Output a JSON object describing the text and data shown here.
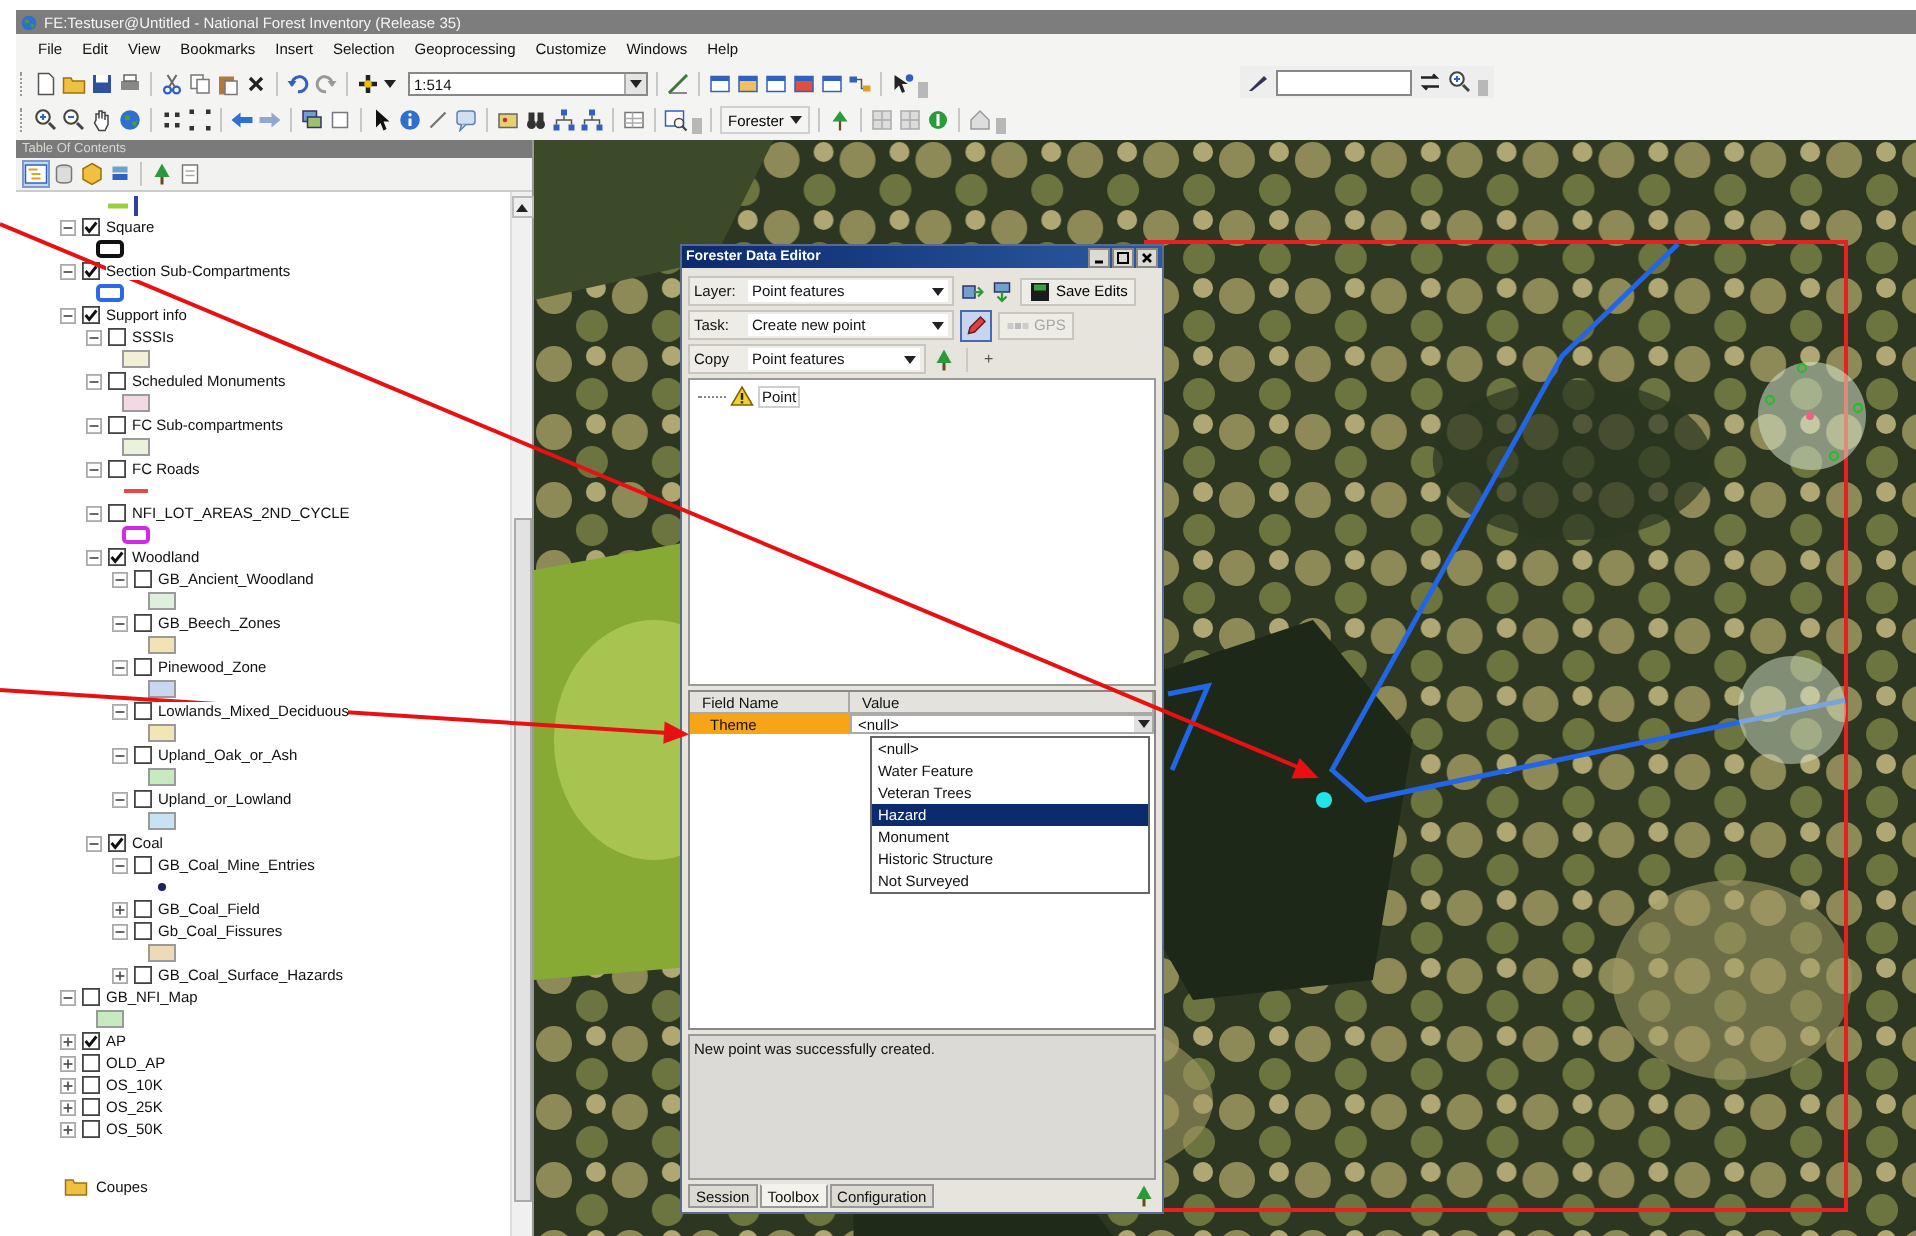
{
  "window": {
    "title": "FE:Testuser@Untitled - National Forest Inventory (Release 35)"
  },
  "menu": [
    "File",
    "Edit",
    "View",
    "Bookmarks",
    "Insert",
    "Selection",
    "Geoprocessing",
    "Customize",
    "Windows",
    "Help"
  ],
  "toolbar": {
    "scale": "1:514",
    "forester_menu": "Forester"
  },
  "toc": {
    "title": "Table Of Contents",
    "layers": [
      {
        "name": "Square",
        "checked": true,
        "expanded": true,
        "legend": {
          "kind": "outline",
          "color": "#111111"
        }
      },
      {
        "name": "Section Sub-Compartments",
        "checked": true,
        "expanded": true,
        "legend": {
          "kind": "outline",
          "color": "#2a6ae8"
        }
      },
      {
        "name": "Support info",
        "checked": true,
        "expanded": true,
        "children": [
          {
            "name": "SSSIs",
            "checked": false,
            "expanded": true,
            "legend": {
              "kind": "fill",
              "color": "#f2f0d4"
            }
          },
          {
            "name": "Scheduled Monuments",
            "checked": false,
            "expanded": true,
            "legend": {
              "kind": "fill",
              "color": "#f4d8e4"
            }
          },
          {
            "name": "FC Sub-compartments",
            "checked": false,
            "expanded": true,
            "legend": {
              "kind": "fill",
              "color": "#eaf2dc"
            }
          },
          {
            "name": "FC Roads",
            "checked": false,
            "expanded": true,
            "legend": {
              "kind": "line",
              "color": "#e84848"
            }
          },
          {
            "name": "NFI_LOT_AREAS_2ND_CYCLE",
            "checked": false,
            "expanded": true,
            "legend": {
              "kind": "outline",
              "color": "#d428e8"
            }
          },
          {
            "name": "Woodland",
            "checked": true,
            "expanded": true,
            "children": [
              {
                "name": "GB_Ancient_Woodland",
                "checked": false,
                "expanded": true,
                "legend": {
                  "kind": "fill",
                  "color": "#dcf0dc"
                }
              },
              {
                "name": "GB_Beech_Zones",
                "checked": false,
                "expanded": true,
                "legend": {
                  "kind": "fill",
                  "color": "#f2e2b4"
                }
              },
              {
                "name": "Pinewood_Zone",
                "checked": false,
                "expanded": true,
                "legend": {
                  "kind": "fill",
                  "color": "#c8d8f0"
                }
              },
              {
                "name": "Lowlands_Mixed_Deciduous",
                "checked": false,
                "expanded": true,
                "legend": {
                  "kind": "fill",
                  "color": "#f2e6b4"
                }
              },
              {
                "name": "Upland_Oak_or_Ash",
                "checked": false,
                "expanded": true,
                "legend": {
                  "kind": "fill",
                  "color": "#c8eac0"
                }
              },
              {
                "name": "Upland_or_Lowland",
                "checked": false,
                "expanded": true,
                "legend": {
                  "kind": "fill",
                  "color": "#c8e2f4"
                }
              }
            ]
          },
          {
            "name": "Coal",
            "checked": true,
            "expanded": true,
            "children": [
              {
                "name": "GB_Coal_Mine_Entries",
                "checked": false,
                "expanded": true,
                "legend": {
                  "kind": "dot",
                  "color": "#20205a"
                }
              },
              {
                "name": "GB_Coal_Field",
                "checked": false,
                "expanded": false
              },
              {
                "name": "Gb_Coal_Fissures",
                "checked": false,
                "expanded": true,
                "legend": {
                  "kind": "fill",
                  "color": "#eedab4"
                }
              },
              {
                "name": "GB_Coal_Surface_Hazards",
                "checked": false,
                "expanded": false
              }
            ]
          }
        ]
      },
      {
        "name": "GB_NFI_Map",
        "checked": false,
        "expanded": true,
        "legend": {
          "kind": "fill",
          "color": "#c8eac0"
        }
      },
      {
        "name": "AP",
        "checked": true,
        "expanded": false
      },
      {
        "name": "OLD_AP",
        "checked": false,
        "expanded": false
      },
      {
        "name": "OS_10K",
        "checked": false,
        "expanded": false
      },
      {
        "name": "OS_25K",
        "checked": false,
        "expanded": false
      },
      {
        "name": "OS_50K",
        "checked": false,
        "expanded": false
      }
    ],
    "folders": [
      "Coupes"
    ]
  },
  "dialog": {
    "title": "Forester Data Editor",
    "layer": {
      "label": "Layer:",
      "value": "Point features"
    },
    "save_button": "Save Edits",
    "task": {
      "label": "Task:",
      "value": "Create new point"
    },
    "edit_tool": {
      "selected": true
    },
    "gps_button": {
      "label": "GPS",
      "disabled": true
    },
    "copy": {
      "label": "Copy",
      "value": "Point features"
    },
    "add_button": "+",
    "tree": [
      {
        "label": "Point"
      }
    ],
    "grid": {
      "columns": [
        "Field Name",
        "Value"
      ],
      "rows": [
        {
          "field": "Theme",
          "value": "<null>",
          "selected": true
        }
      ]
    },
    "dropdown": {
      "options": [
        {
          "label": "<null>",
          "selected": false
        },
        {
          "label": "Water Feature",
          "selected": false
        },
        {
          "label": "Veteran Trees",
          "selected": false
        },
        {
          "label": "Hazard",
          "selected": true
        },
        {
          "label": "Monument",
          "selected": false
        },
        {
          "label": "Historic Structure",
          "selected": false
        },
        {
          "label": "Not Surveyed",
          "selected": false
        }
      ]
    },
    "message": "New point was successfully created.",
    "tabs": [
      {
        "label": "Session",
        "selected": false
      },
      {
        "label": "Toolbox",
        "selected": true
      },
      {
        "label": "Configuration",
        "selected": false
      }
    ]
  }
}
